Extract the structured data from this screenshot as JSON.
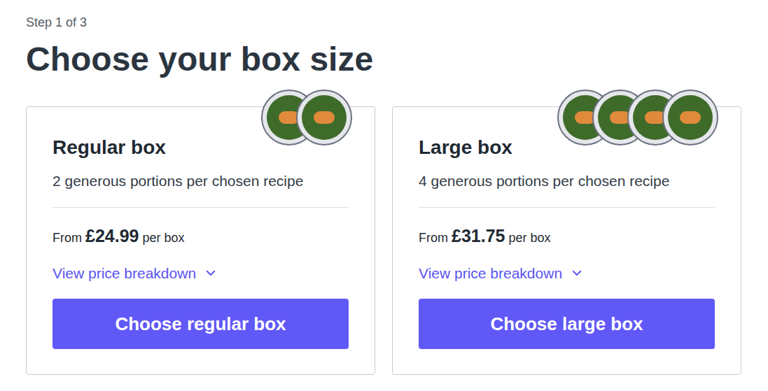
{
  "step": "Step 1 of 3",
  "heading": "Choose your box size",
  "boxes": [
    {
      "title": "Regular box",
      "description": "2 generous portions per chosen recipe",
      "from": "From",
      "price": "£24.99",
      "per": "per box",
      "link": "View price breakdown",
      "expanded": false,
      "button": "Choose regular box",
      "plates": 2
    },
    {
      "title": "Large box",
      "description": "4 generous portions per chosen recipe",
      "from": "From",
      "price": "£31.75",
      "per": "per box",
      "link": "View price breakdown",
      "expanded": false,
      "button": "Choose large box",
      "plates": 4
    }
  ]
}
